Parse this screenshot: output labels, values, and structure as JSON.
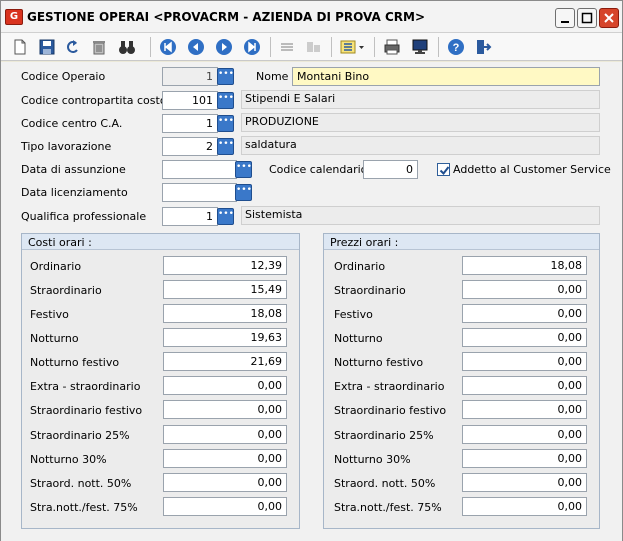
{
  "window": {
    "title": "GESTIONE OPERAI <PROVACRM - AZIENDA DI PROVA CRM>",
    "app_icon_letter": "G"
  },
  "toolbar": {
    "buttons": [
      {
        "name": "new-document-icon"
      },
      {
        "name": "save-icon"
      },
      {
        "name": "undo-icon"
      },
      {
        "name": "delete-icon"
      },
      {
        "name": "search-binoculars-icon"
      },
      {
        "name": "first-record-icon"
      },
      {
        "name": "previous-record-icon"
      },
      {
        "name": "next-record-icon"
      },
      {
        "name": "last-record-icon"
      },
      {
        "name": "disabled-tool-icon"
      },
      {
        "name": "disabled-tool2-icon"
      },
      {
        "name": "list-options-icon"
      },
      {
        "name": "print-icon"
      },
      {
        "name": "monitor-icon"
      },
      {
        "name": "help-icon"
      },
      {
        "name": "exit-icon"
      }
    ]
  },
  "form": {
    "codice_operaio": {
      "label": "Codice Operaio",
      "value": "1"
    },
    "nome": {
      "label": "Nome",
      "value": "Montani Bino"
    },
    "contropartita": {
      "label": "Codice contropartita costo",
      "value": "101",
      "desc": "Stipendi E Salari"
    },
    "centro_ca": {
      "label": "Codice centro C.A.",
      "value": "1",
      "desc": "PRODUZIONE"
    },
    "tipo_lavorazione": {
      "label": "Tipo lavorazione",
      "value": "2",
      "desc": "saldatura"
    },
    "data_assunzione": {
      "label": "Data di assunzione",
      "value": ""
    },
    "codice_calendario": {
      "label": "Codice calendario",
      "value": "0"
    },
    "customer_service": {
      "label": "Addetto al Customer Service",
      "checked": true
    },
    "data_licenziamento": {
      "label": "Data licenziamento",
      "value": ""
    },
    "qualifica": {
      "label": "Qualifica professionale",
      "value": "1",
      "desc": "Sistemista"
    }
  },
  "costi": {
    "title": "Costi orari :",
    "rows": [
      {
        "label": "Ordinario",
        "value": "12,39"
      },
      {
        "label": "Straordinario",
        "value": "15,49"
      },
      {
        "label": "Festivo",
        "value": "18,08"
      },
      {
        "label": "Notturno",
        "value": "19,63"
      },
      {
        "label": "Notturno festivo",
        "value": "21,69"
      },
      {
        "label": "Extra - straordinario",
        "value": "0,00"
      },
      {
        "label": "Straordinario festivo",
        "value": "0,00"
      },
      {
        "label": "Straordinario 25%",
        "value": "0,00"
      },
      {
        "label": "Notturno 30%",
        "value": "0,00"
      },
      {
        "label": "Straord. nott. 50%",
        "value": "0,00"
      },
      {
        "label": "Stra.nott./fest. 75%",
        "value": "0,00"
      }
    ]
  },
  "prezzi": {
    "title": "Prezzi orari :",
    "rows": [
      {
        "label": "Ordinario",
        "value": "18,08"
      },
      {
        "label": "Straordinario",
        "value": "0,00"
      },
      {
        "label": "Festivo",
        "value": "0,00"
      },
      {
        "label": "Notturno",
        "value": "0,00"
      },
      {
        "label": "Notturno festivo",
        "value": "0,00"
      },
      {
        "label": "Extra - straordinario",
        "value": "0,00"
      },
      {
        "label": "Straordinario festivo",
        "value": "0,00"
      },
      {
        "label": "Straordinario 25%",
        "value": "0,00"
      },
      {
        "label": "Notturno 30%",
        "value": "0,00"
      },
      {
        "label": "Straord. nott. 50%",
        "value": "0,00"
      },
      {
        "label": "Stra.nott./fest. 75%",
        "value": "0,00"
      }
    ]
  },
  "colors": {
    "accent": "#3a78c9",
    "name_field": "#fff9c4",
    "close_button": "#d6452b"
  }
}
